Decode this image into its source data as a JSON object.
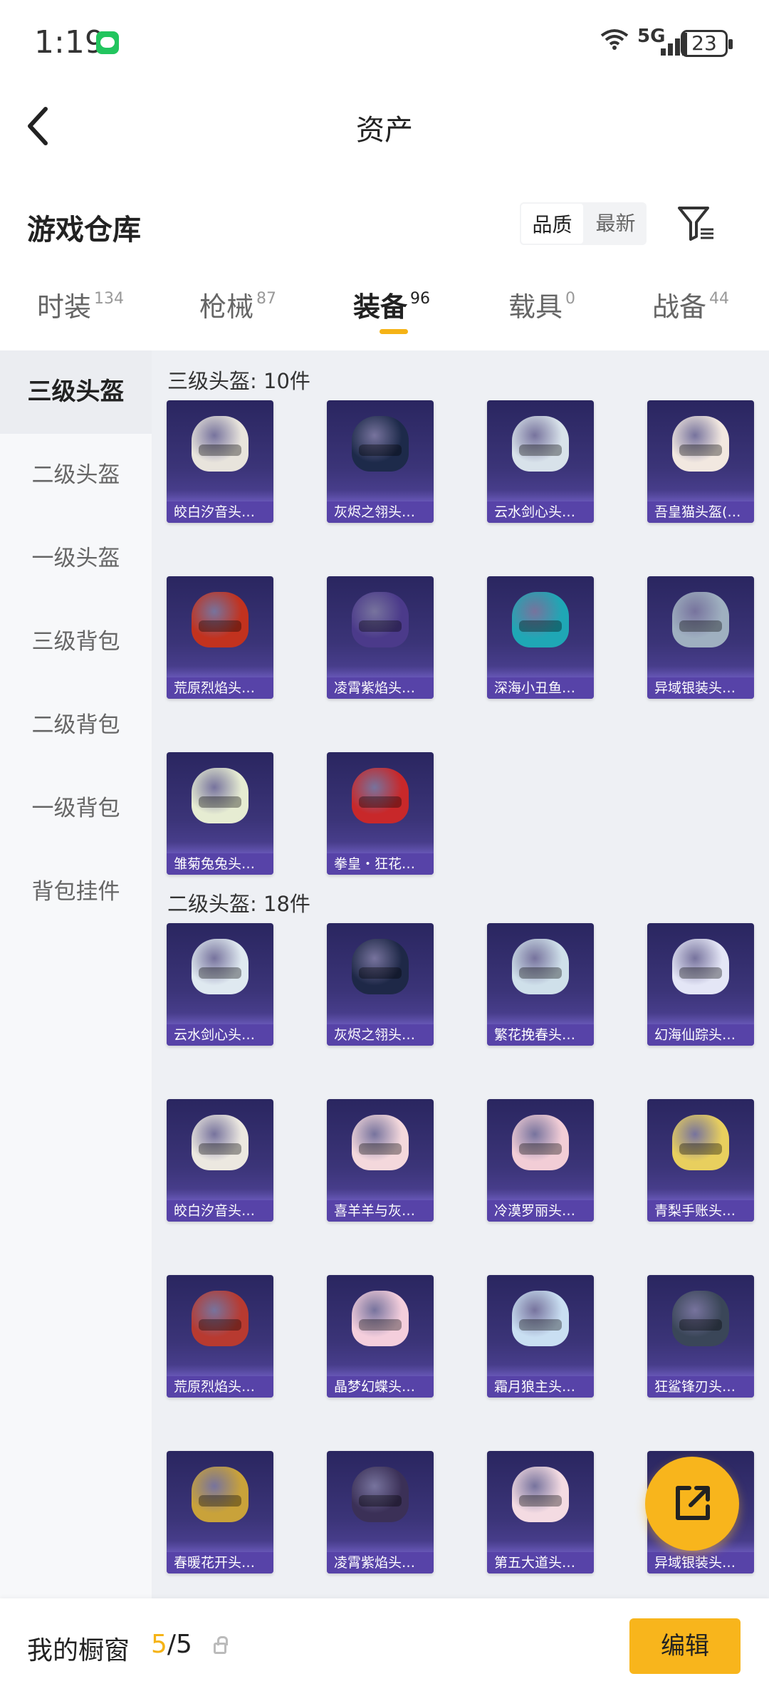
{
  "status": {
    "time": "1:19",
    "network": "5G",
    "battery": "23"
  },
  "header": {
    "title": "资产"
  },
  "section": {
    "title": "游戏仓库",
    "sort": [
      {
        "label": "品质",
        "active": true
      },
      {
        "label": "最新",
        "active": false
      }
    ]
  },
  "tabs": [
    {
      "label": "时装",
      "count": "134"
    },
    {
      "label": "枪械",
      "count": "87"
    },
    {
      "label": "装备",
      "count": "96",
      "active": true
    },
    {
      "label": "载具",
      "count": "0"
    },
    {
      "label": "战备",
      "count": "44"
    }
  ],
  "sidebar": [
    {
      "label": "三级头盔",
      "active": true
    },
    {
      "label": "二级头盔"
    },
    {
      "label": "一级头盔"
    },
    {
      "label": "三级背包"
    },
    {
      "label": "二级背包"
    },
    {
      "label": "一级背包"
    },
    {
      "label": "背包挂件"
    }
  ],
  "groups": [
    {
      "title": "三级头盔: 10件",
      "items": [
        {
          "name": "皎白汐音头…",
          "color": "#e8e4dc"
        },
        {
          "name": "灰烬之翎头…",
          "color": "#1d2a4a"
        },
        {
          "name": "云水剑心头…",
          "color": "#d8e2ea"
        },
        {
          "name": "吾皇猫头盔(…",
          "color": "#f2e8e0"
        },
        {
          "name": "荒原烈焰头…",
          "color": "#c2321e"
        },
        {
          "name": "凌霄紫焰头…",
          "color": "#4b3a8a"
        },
        {
          "name": "深海小丑鱼…",
          "color": "#1fa7b5"
        },
        {
          "name": "异域银装头…",
          "color": "#9fb0c0"
        },
        {
          "name": "雏菊兔兔头…",
          "color": "#e6ecd2"
        },
        {
          "name": "拳皇・狂花…",
          "color": "#c8282a"
        }
      ]
    },
    {
      "title": "二级头盔: 18件",
      "items": [
        {
          "name": "云水剑心头…",
          "color": "#dfe9f0"
        },
        {
          "name": "灰烬之翎头…",
          "color": "#1e2847"
        },
        {
          "name": "繁花挽春头…",
          "color": "#cfe0ea"
        },
        {
          "name": "幻海仙踪头…",
          "color": "#e4e6f6"
        },
        {
          "name": "皎白汐音头…",
          "color": "#ece8e0"
        },
        {
          "name": "喜羊羊与灰…",
          "color": "#f4d8dc"
        },
        {
          "name": "冷漠罗丽头…",
          "color": "#f2cdd6"
        },
        {
          "name": "青梨手账头…",
          "color": "#e8cf5e"
        },
        {
          "name": "荒原烈焰头…",
          "color": "#b83a30"
        },
        {
          "name": "晶梦幻蝶头…",
          "color": "#f4cedc"
        },
        {
          "name": "霜月狼主头…",
          "color": "#c9dff2"
        },
        {
          "name": "狂鲨锋刃头…",
          "color": "#3a4658"
        },
        {
          "name": "春暖花开头…",
          "color": "#c9a23a"
        },
        {
          "name": "凌霄紫焰头…",
          "color": "#3b3057"
        },
        {
          "name": "第五大道头…",
          "color": "#f4dbe2"
        },
        {
          "name": "异域银装头…",
          "color": "#a9b6c4"
        }
      ]
    }
  ],
  "footer": {
    "label": "我的橱窗",
    "current": "5",
    "total": "/5",
    "edit": "编辑"
  }
}
